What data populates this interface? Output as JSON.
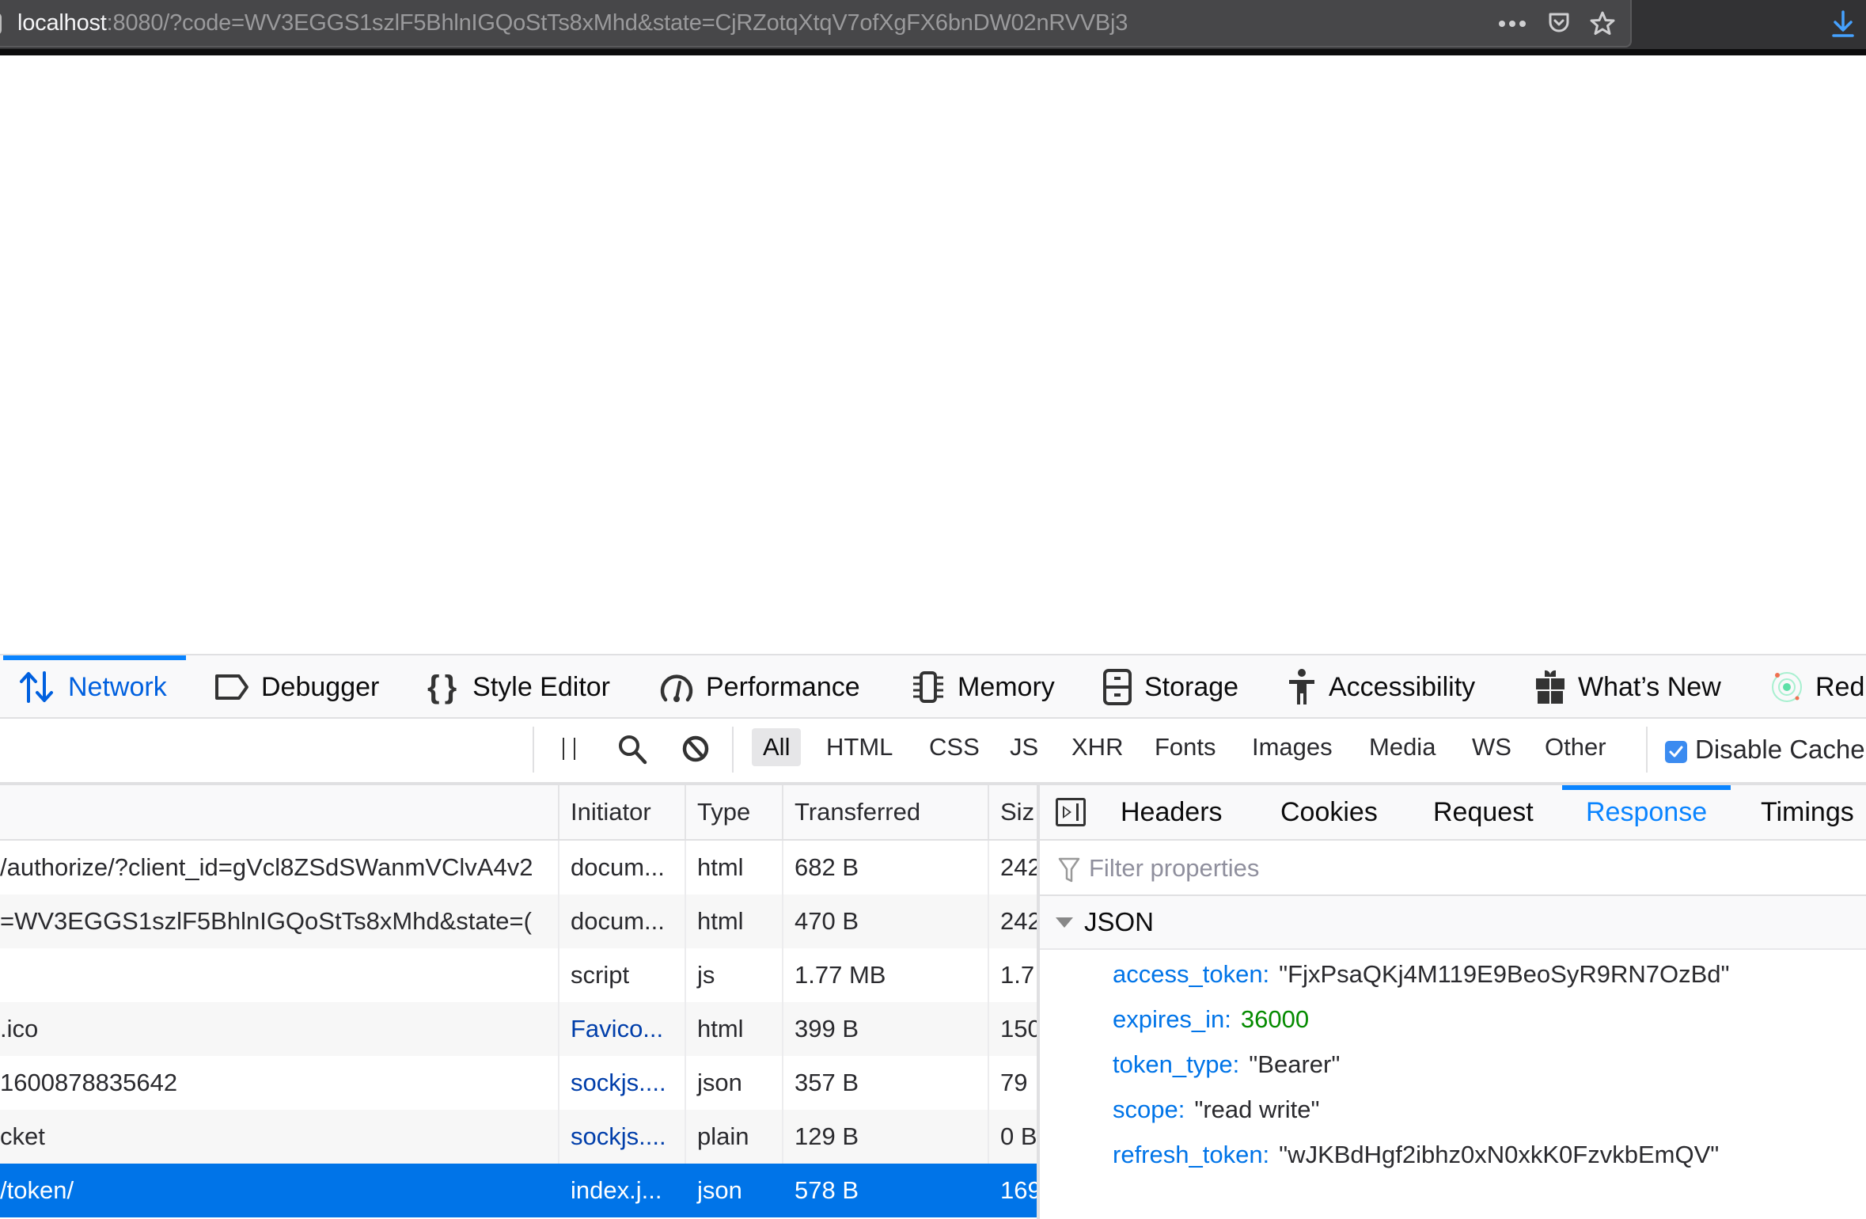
{
  "browser": {
    "url_host": "localhost",
    "url_rest": ":8080/?code=WV3EGGS1szlF5BhlnIGQoStTs8xMhd&state=CjRZotqXtqV7ofXgFX6bnDW02nRVVBj3",
    "icons": [
      "lock-icon",
      "more-actions-icon",
      "pocket-icon",
      "bookmark-star-icon",
      "download-icon"
    ]
  },
  "devtools": {
    "tabs": [
      {
        "label": "Network",
        "icon": "network-arrows-icon",
        "active": true
      },
      {
        "label": "Debugger",
        "icon": "debugger-icon"
      },
      {
        "label": "Style Editor",
        "icon": "braces-icon"
      },
      {
        "label": "Performance",
        "icon": "gauge-icon"
      },
      {
        "label": "Memory",
        "icon": "memory-chip-icon"
      },
      {
        "label": "Storage",
        "icon": "storage-cabinet-icon"
      },
      {
        "label": "Accessibility",
        "icon": "accessibility-person-icon"
      },
      {
        "label": "What’s New",
        "icon": "gift-icon"
      },
      {
        "label": "Red",
        "icon": "redux-atom-icon"
      }
    ],
    "filter_bar": {
      "pause_icon": "pause-icon",
      "search_icon": "search-icon",
      "clear_icon": "block-icon",
      "types": [
        "All",
        "HTML",
        "CSS",
        "JS",
        "XHR",
        "Fonts",
        "Images",
        "Media",
        "WS",
        "Other"
      ],
      "active_type": "All",
      "disable_cache_label": "Disable Cache",
      "disable_cache_checked": true
    },
    "request_table": {
      "columns": [
        "",
        "Initiator",
        "Type",
        "Transferred",
        "Siz"
      ],
      "rows": [
        {
          "name": "/authorize/?client_id=gVcl8ZSdSWanmVClvA4v2",
          "initiator": "docum...",
          "initiator_link": false,
          "type": "html",
          "transferred": "682 B",
          "size": "242"
        },
        {
          "name": "=WV3EGGS1szlF5BhlnIGQoStTs8xMhd&state=(",
          "initiator": "docum...",
          "initiator_link": false,
          "type": "html",
          "transferred": "470 B",
          "size": "242"
        },
        {
          "name": "",
          "initiator": "script",
          "initiator_link": false,
          "type": "js",
          "transferred": "1.77 MB",
          "size": "1.7"
        },
        {
          "name": ".ico",
          "initiator": "Favico...",
          "initiator_link": true,
          "type": "html",
          "transferred": "399 B",
          "size": "150"
        },
        {
          "name": "1600878835642",
          "initiator": "sockjs....",
          "initiator_link": true,
          "type": "json",
          "transferred": "357 B",
          "size": "79"
        },
        {
          "name": "cket",
          "initiator": "sockjs....",
          "initiator_link": true,
          "type": "plain",
          "transferred": "129 B",
          "size": "0 B"
        },
        {
          "name": "/token/",
          "initiator": "index.j...",
          "initiator_link": true,
          "type": "json",
          "transferred": "578 B",
          "size": "169",
          "selected": true
        }
      ]
    },
    "detail": {
      "tabs": [
        "Headers",
        "Cookies",
        "Request",
        "Response",
        "Timings"
      ],
      "active_tab": "Response",
      "filter_placeholder": "Filter properties",
      "json_section_label": "JSON",
      "json_entries": [
        {
          "key": "access_token:",
          "value": "\"FjxPsaQKj4M119E9BeoSyR9RN7OzBd\"",
          "kind": "string"
        },
        {
          "key": "expires_in:",
          "value": "36000",
          "kind": "number"
        },
        {
          "key": "token_type:",
          "value": "\"Bearer\"",
          "kind": "string"
        },
        {
          "key": "scope:",
          "value": "\"read write\"",
          "kind": "string"
        },
        {
          "key": "refresh_token:",
          "value": "\"wJKBdHgf2ibhz0xN0xkK0FzvkbEmQV\"",
          "kind": "string"
        }
      ]
    },
    "colors": {
      "accent": "#0a84ff",
      "selected_row": "#0074e8",
      "json_key": "#0074e8",
      "json_number": "#058b00",
      "link": "#003eaa"
    }
  }
}
